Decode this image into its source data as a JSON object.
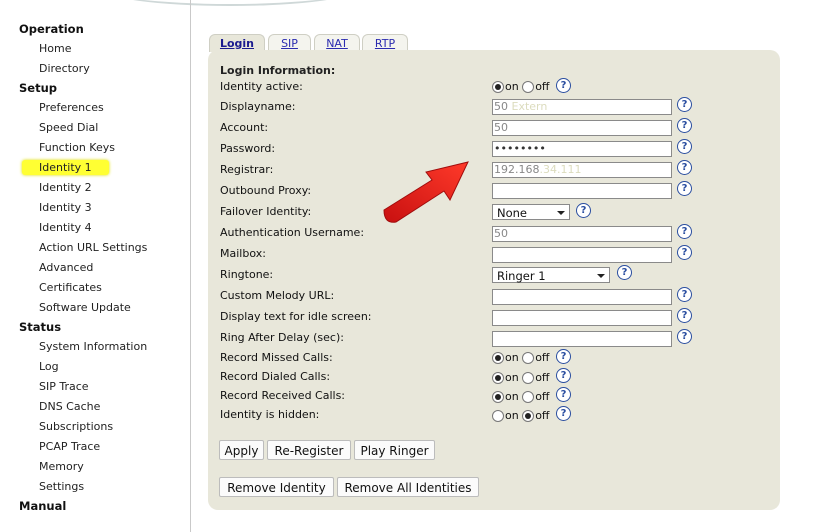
{
  "sidebar": {
    "sections": [
      {
        "title": "Operation",
        "items": [
          "Home",
          "Directory"
        ]
      },
      {
        "title": "Setup",
        "items": [
          "Preferences",
          "Speed Dial",
          "Function Keys",
          "Identity 1",
          "Identity 2",
          "Identity 3",
          "Identity 4",
          "Action URL Settings",
          "Advanced",
          "Certificates",
          "Software Update"
        ]
      },
      {
        "title": "Status",
        "items": [
          "System Information",
          "Log",
          "SIP Trace",
          "DNS Cache",
          "Subscriptions",
          "PCAP Trace",
          "Memory",
          "Settings"
        ]
      },
      {
        "title": "Manual",
        "items": []
      }
    ],
    "active_item": "Identity 1"
  },
  "tabs": [
    "Login",
    "SIP",
    "NAT",
    "RTP"
  ],
  "active_tab": "Login",
  "form": {
    "heading": "Login Information:",
    "radio_on": "on",
    "radio_off": "off",
    "help_glyph": "?",
    "labels": {
      "identity_active": "Identity active:",
      "displayname": "Displayname:",
      "account": "Account:",
      "password": "Password:",
      "registrar": "Registrar:",
      "outbound_proxy": "Outbound Proxy:",
      "failover_identity": "Failover Identity:",
      "auth_username": "Authentication Username:",
      "mailbox": "Mailbox:",
      "ringtone": "Ringtone:",
      "custom_melody_url": "Custom Melody URL:",
      "display_text_idle": "Display text for idle screen:",
      "ring_after_delay": "Ring After Delay (sec):",
      "record_missed": "Record Missed Calls:",
      "record_dialed": "Record Dialed Calls:",
      "record_received": "Record Received Calls:",
      "identity_hidden": "Identity is hidden:"
    },
    "values": {
      "displayname": "50",
      "displayname_faint": "Extern",
      "account": "50",
      "password": "••••••••",
      "registrar": "192.168",
      "registrar_faint": ".34.111",
      "outbound_proxy": "",
      "failover_identity": "None",
      "auth_username": "50",
      "mailbox": "",
      "ringtone": "Ringer 1",
      "custom_melody_url": "",
      "display_text_idle": "",
      "ring_after_delay": ""
    },
    "radios": {
      "identity_active": "on",
      "record_missed": "on",
      "record_dialed": "on",
      "record_received": "on",
      "identity_hidden": "off"
    }
  },
  "buttons": {
    "apply": "Apply",
    "re_register": "Re-Register",
    "play_ringer": "Play Ringer",
    "remove_identity": "Remove Identity",
    "remove_all": "Remove All Identities"
  },
  "colors": {
    "panel_bg": "#e8e7da",
    "active_highlight": "#ffff33",
    "arrow": "#e0201b",
    "help_icon": "#2a4ea0"
  }
}
